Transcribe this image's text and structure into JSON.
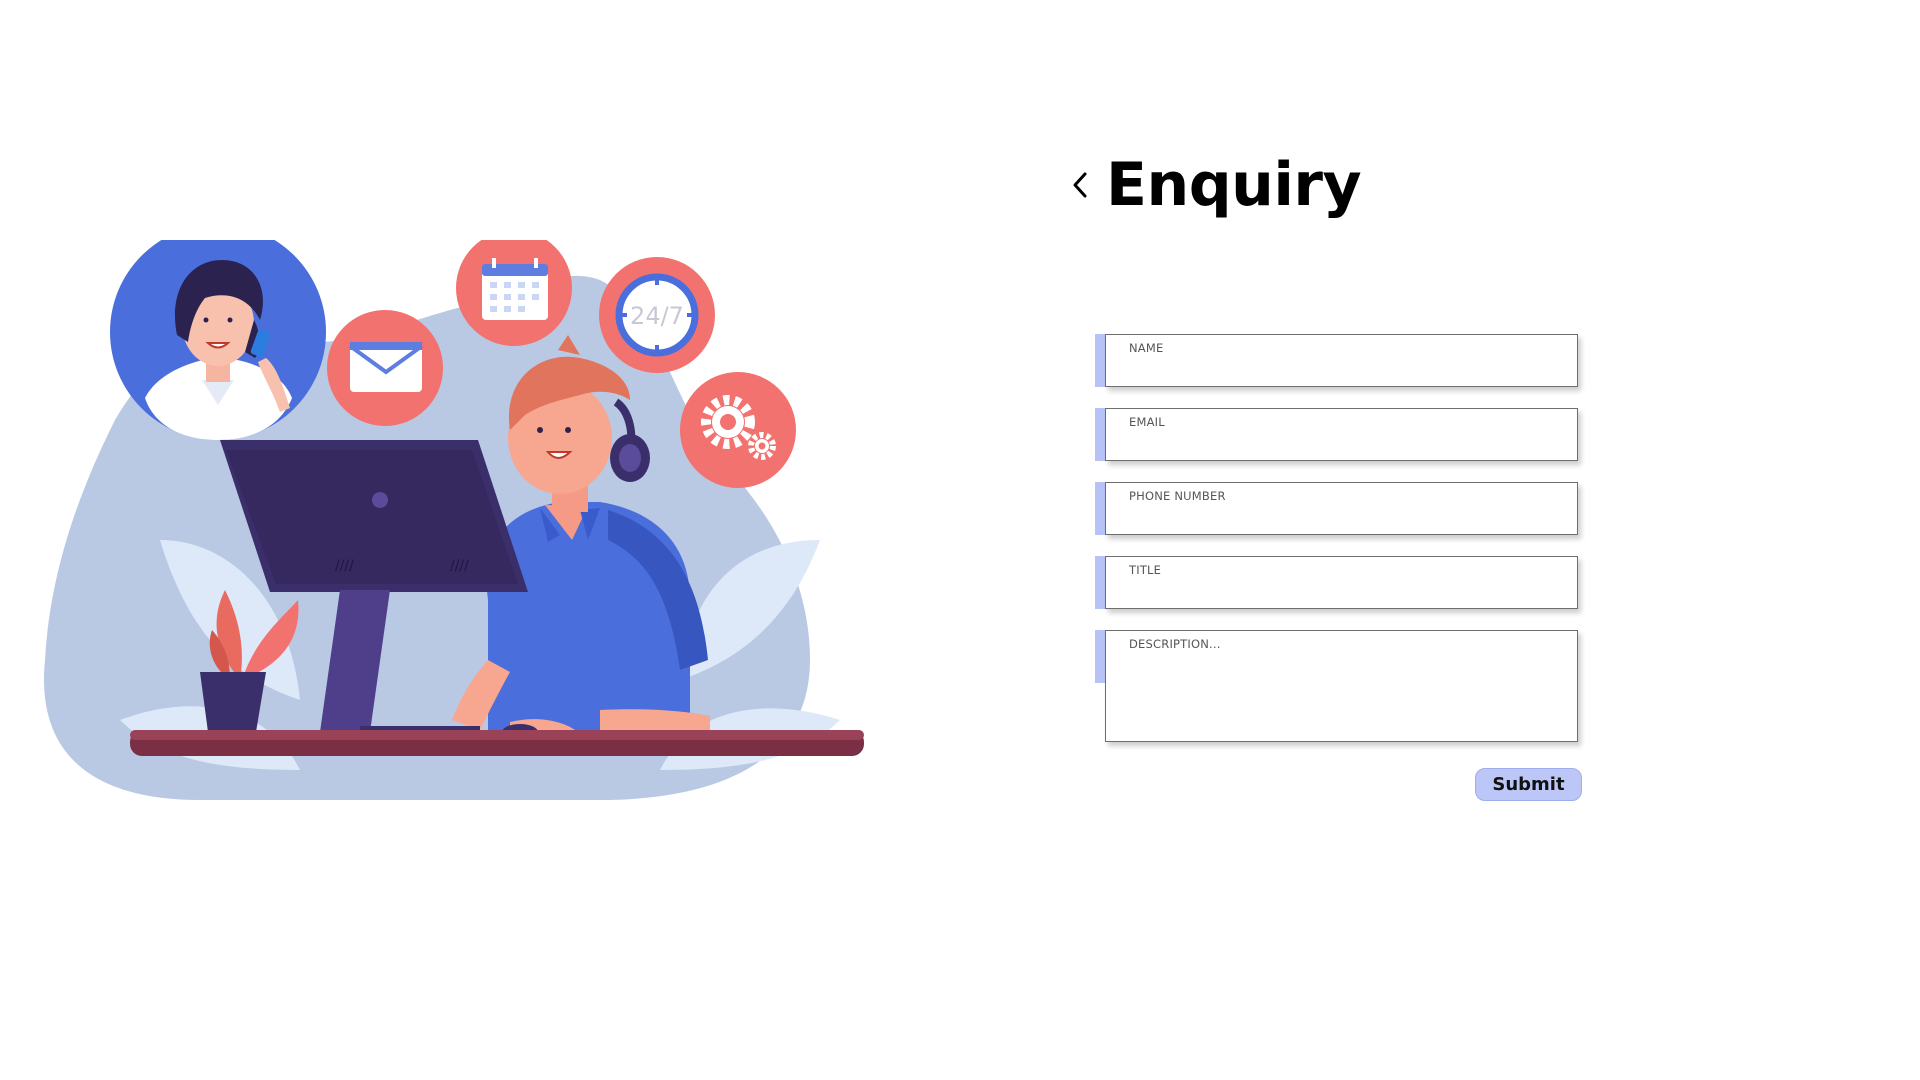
{
  "header": {
    "title": "Enquiry",
    "back_icon": "chevron-left-icon"
  },
  "form": {
    "name_label": "NAME",
    "email_label": "EMAIL",
    "phone_label": "PHONE NUMBER",
    "title_label": "TITLE",
    "description_placeholder": "DESCRIPTION...",
    "submit_label": "Submit"
  },
  "illustration": {
    "clock_text": "24/7",
    "icons": [
      "envelope-icon",
      "calendar-icon",
      "clock-icon",
      "gear-icon"
    ]
  },
  "colors": {
    "accent": "#b7c3f7",
    "button": "#bcc7f8",
    "blob": "#b9c9e4",
    "coral": "#f2726f",
    "brand_blue": "#4a6fdc"
  }
}
